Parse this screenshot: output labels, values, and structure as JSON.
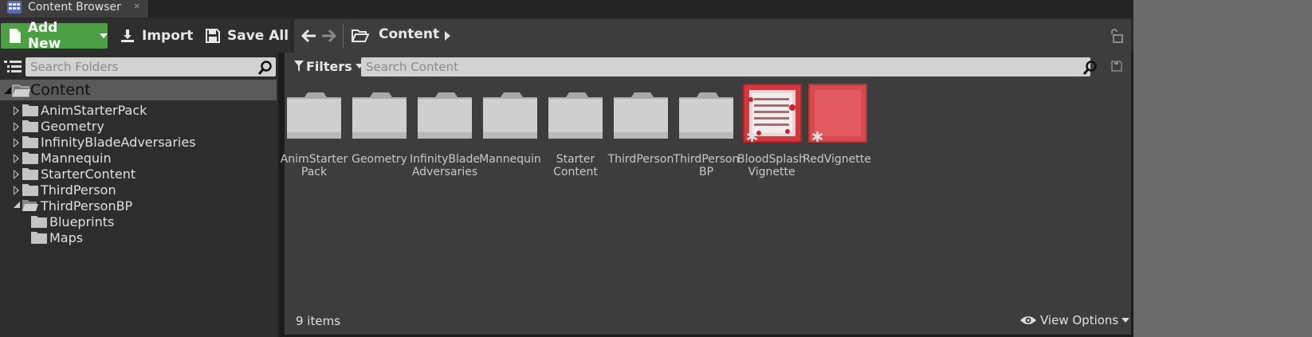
{
  "tab": {
    "title": "Content Browser",
    "close": "×"
  },
  "toolbar": {
    "add_new_label": "Add New",
    "import_label": "Import",
    "save_all_label": "Save All"
  },
  "path": {
    "current": "Content"
  },
  "left": {
    "search_placeholder": "Search Folders",
    "root_label": "Content",
    "folders": [
      {
        "label": "AnimStarterPack",
        "expanded": false
      },
      {
        "label": "Geometry",
        "expanded": false
      },
      {
        "label": "InfinityBladeAdversaries",
        "expanded": false
      },
      {
        "label": "Mannequin",
        "expanded": false
      },
      {
        "label": "StarterContent",
        "expanded": false
      },
      {
        "label": "ThirdPerson",
        "expanded": false
      },
      {
        "label": "ThirdPersonBP",
        "expanded": true
      }
    ],
    "subfolders": [
      {
        "label": "Blueprints"
      },
      {
        "label": "Maps"
      }
    ]
  },
  "right": {
    "filters_label": "Filters",
    "search_placeholder": "Search Content",
    "assets": [
      {
        "line1": "AnimStarter",
        "line2": "Pack",
        "kind": "folder"
      },
      {
        "line1": "Geometry",
        "line2": "",
        "kind": "folder"
      },
      {
        "line1": "InfinityBlade",
        "line2": "Adversaries",
        "kind": "folder"
      },
      {
        "line1": "Mannequin",
        "line2": "",
        "kind": "folder"
      },
      {
        "line1": "Starter",
        "line2": "Content",
        "kind": "folder"
      },
      {
        "line1": "ThirdPerson",
        "line2": "",
        "kind": "folder"
      },
      {
        "line1": "ThirdPerson",
        "line2": "BP",
        "kind": "folder"
      },
      {
        "line1": "BloodSplash",
        "line2": "Vignette",
        "kind": "texture"
      },
      {
        "line1": "RedVignette",
        "line2": "",
        "kind": "texture"
      }
    ],
    "item_count": "9 items",
    "view_options_label": "View Options"
  },
  "colors": {
    "accent_green": "#4aa042",
    "panel": "#3d3d3d",
    "texture_red": "#d94a4f"
  }
}
